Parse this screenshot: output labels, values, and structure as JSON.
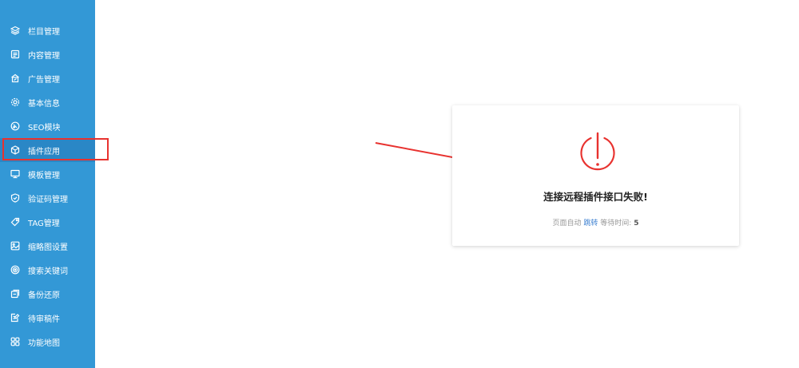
{
  "sidebar": {
    "background": "#3398d6",
    "items": [
      {
        "label": "栏目管理",
        "icon": "layers-icon"
      },
      {
        "label": "内容管理",
        "icon": "document-icon"
      },
      {
        "label": "广告管理",
        "icon": "advert-icon"
      },
      {
        "label": "基本信息",
        "icon": "gear-icon"
      },
      {
        "label": "SEO模块",
        "icon": "seo-icon"
      },
      {
        "label": "插件应用",
        "icon": "cube-icon",
        "active": true
      },
      {
        "label": "模板管理",
        "icon": "monitor-icon"
      },
      {
        "label": "验证码管理",
        "icon": "shield-check-icon"
      },
      {
        "label": "TAG管理",
        "icon": "tag-icon"
      },
      {
        "label": "缩略图设置",
        "icon": "image-icon"
      },
      {
        "label": "搜索关键词",
        "icon": "target-icon"
      },
      {
        "label": "备份还原",
        "icon": "backup-icon"
      },
      {
        "label": "待审稿件",
        "icon": "edit-doc-icon"
      },
      {
        "label": "功能地图",
        "icon": "grid-icon"
      }
    ]
  },
  "annotation": {
    "highlight_color": "#e8322f"
  },
  "dialog": {
    "icon": "exclamation-circle-icon",
    "icon_color": "#e8322f",
    "message": "连接远程插件接口失败!",
    "redirect_prefix": "页面自动",
    "redirect_link": "跳转",
    "wait_label": "等待时间:",
    "countdown": "5"
  }
}
